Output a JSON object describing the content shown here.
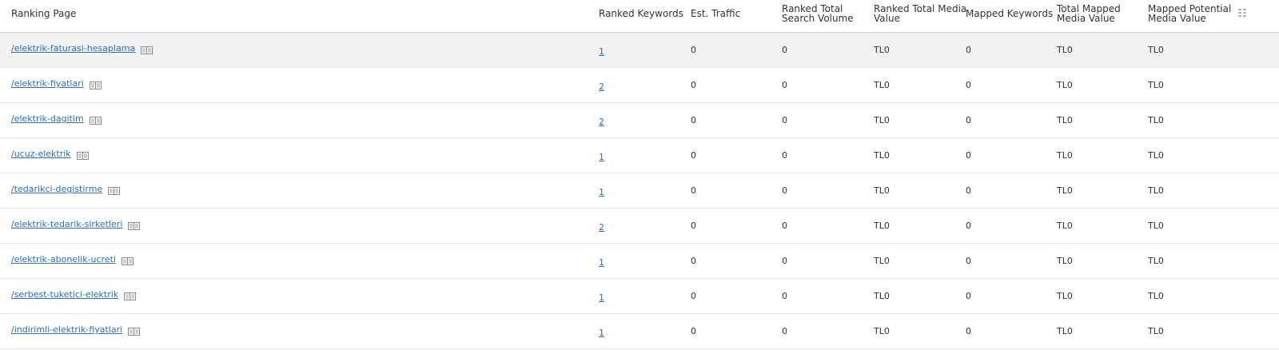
{
  "headers": {
    "ranking_page": "Ranking Page",
    "ranked_keywords": "Ranked Keywords",
    "est_traffic": "Est. Traffic",
    "ranked_total_search_volume": [
      "Ranked Total",
      "Search Volume"
    ],
    "ranked_total_media_value": [
      "Ranked Total Media",
      "Value"
    ],
    "mapped_keywords": "Mapped Keywords",
    "total_mapped_media_value": [
      "Total Mapped",
      "Media Value"
    ],
    "mapped_potential_media_value": [
      "Mapped Potential",
      "Media Value"
    ]
  },
  "icons": {
    "page_icon": "book-icon",
    "columns_icon": "columns-settings-icon"
  },
  "colors": {
    "link": "#2a6eb8",
    "highlight_row": "#f2f2f2"
  },
  "rows": [
    {
      "page": "/elektrik-faturasi-hesaplama",
      "ranked_keywords": "1",
      "est_traffic": "0",
      "search_volume": "0",
      "ranked_media_value": "TL0",
      "mapped_keywords": "0",
      "total_mapped_media_value": "TL0",
      "mapped_potential_media_value": "TL0"
    },
    {
      "page": "/elektrik-fiyatlari",
      "ranked_keywords": "2",
      "est_traffic": "0",
      "search_volume": "0",
      "ranked_media_value": "TL0",
      "mapped_keywords": "0",
      "total_mapped_media_value": "TL0",
      "mapped_potential_media_value": "TL0"
    },
    {
      "page": "/elektrik-dagitim",
      "ranked_keywords": "2",
      "est_traffic": "0",
      "search_volume": "0",
      "ranked_media_value": "TL0",
      "mapped_keywords": "0",
      "total_mapped_media_value": "TL0",
      "mapped_potential_media_value": "TL0"
    },
    {
      "page": "/ucuz-elektrik",
      "ranked_keywords": "1",
      "est_traffic": "0",
      "search_volume": "0",
      "ranked_media_value": "TL0",
      "mapped_keywords": "0",
      "total_mapped_media_value": "TL0",
      "mapped_potential_media_value": "TL0"
    },
    {
      "page": "/tedarikci-degistirme",
      "ranked_keywords": "1",
      "est_traffic": "0",
      "search_volume": "0",
      "ranked_media_value": "TL0",
      "mapped_keywords": "0",
      "total_mapped_media_value": "TL0",
      "mapped_potential_media_value": "TL0"
    },
    {
      "page": "/elektrik-tedarik-sirketleri",
      "ranked_keywords": "2",
      "est_traffic": "0",
      "search_volume": "0",
      "ranked_media_value": "TL0",
      "mapped_keywords": "0",
      "total_mapped_media_value": "TL0",
      "mapped_potential_media_value": "TL0"
    },
    {
      "page": "/elektrik-abonelik-ucreti",
      "ranked_keywords": "1",
      "est_traffic": "0",
      "search_volume": "0",
      "ranked_media_value": "TL0",
      "mapped_keywords": "0",
      "total_mapped_media_value": "TL0",
      "mapped_potential_media_value": "TL0"
    },
    {
      "page": "/serbest-tuketici-elektrik",
      "ranked_keywords": "1",
      "est_traffic": "0",
      "search_volume": "0",
      "ranked_media_value": "TL0",
      "mapped_keywords": "0",
      "total_mapped_media_value": "TL0",
      "mapped_potential_media_value": "TL0"
    },
    {
      "page": "/indirimli-elektrik-fiyatlari",
      "ranked_keywords": "1",
      "est_traffic": "0",
      "search_volume": "0",
      "ranked_media_value": "TL0",
      "mapped_keywords": "0",
      "total_mapped_media_value": "TL0",
      "mapped_potential_media_value": "TL0"
    }
  ]
}
